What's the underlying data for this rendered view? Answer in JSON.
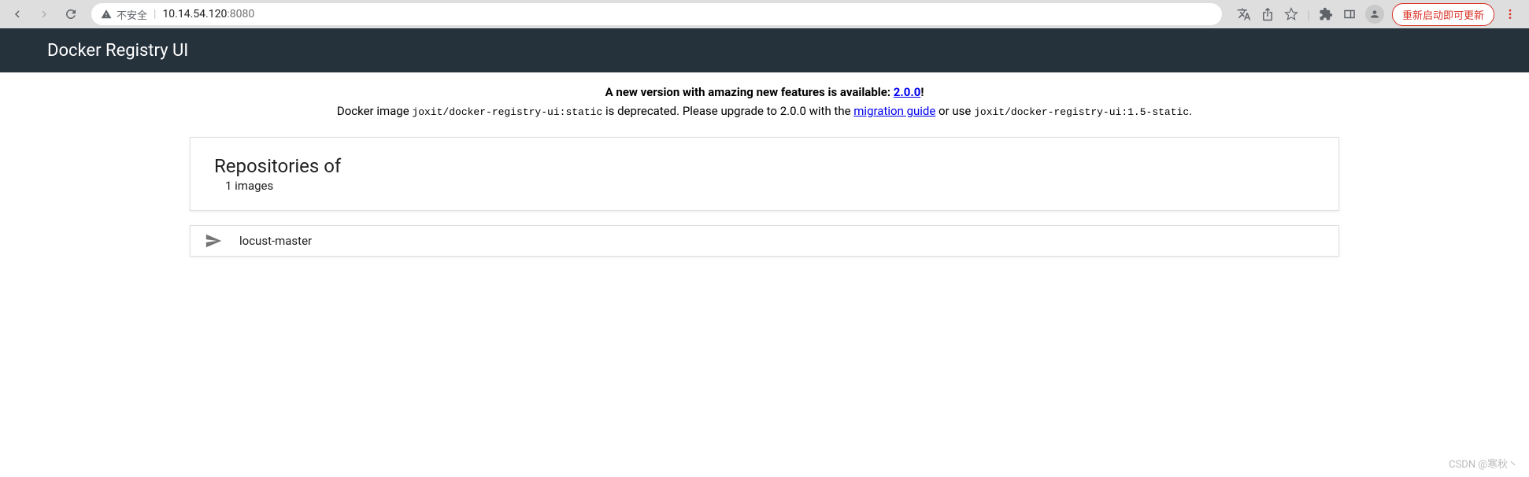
{
  "browser": {
    "security_label": "不安全",
    "url_host": "10.14.54.120",
    "url_port": ":8080",
    "update_button": "重新启动即可更新"
  },
  "header": {
    "title": "Docker Registry UI"
  },
  "notice": {
    "line1_prefix": "A new version with amazing new features is available: ",
    "version_link": "2.0.0",
    "line1_suffix": "!",
    "line2_a": "Docker image ",
    "line2_code1": "joxit/docker-registry-ui:static",
    "line2_b": " is deprecated. Please upgrade to 2.0.0 with the ",
    "migration_link": "migration guide",
    "line2_c": " or use ",
    "line2_code2": "joxit/docker-registry-ui:1.5-static",
    "line2_d": "."
  },
  "main": {
    "repos_title": "Repositories of",
    "repos_count": "1 images",
    "repos": [
      {
        "name": "locust-master"
      }
    ]
  },
  "watermark": "CSDN @寒秋丶"
}
